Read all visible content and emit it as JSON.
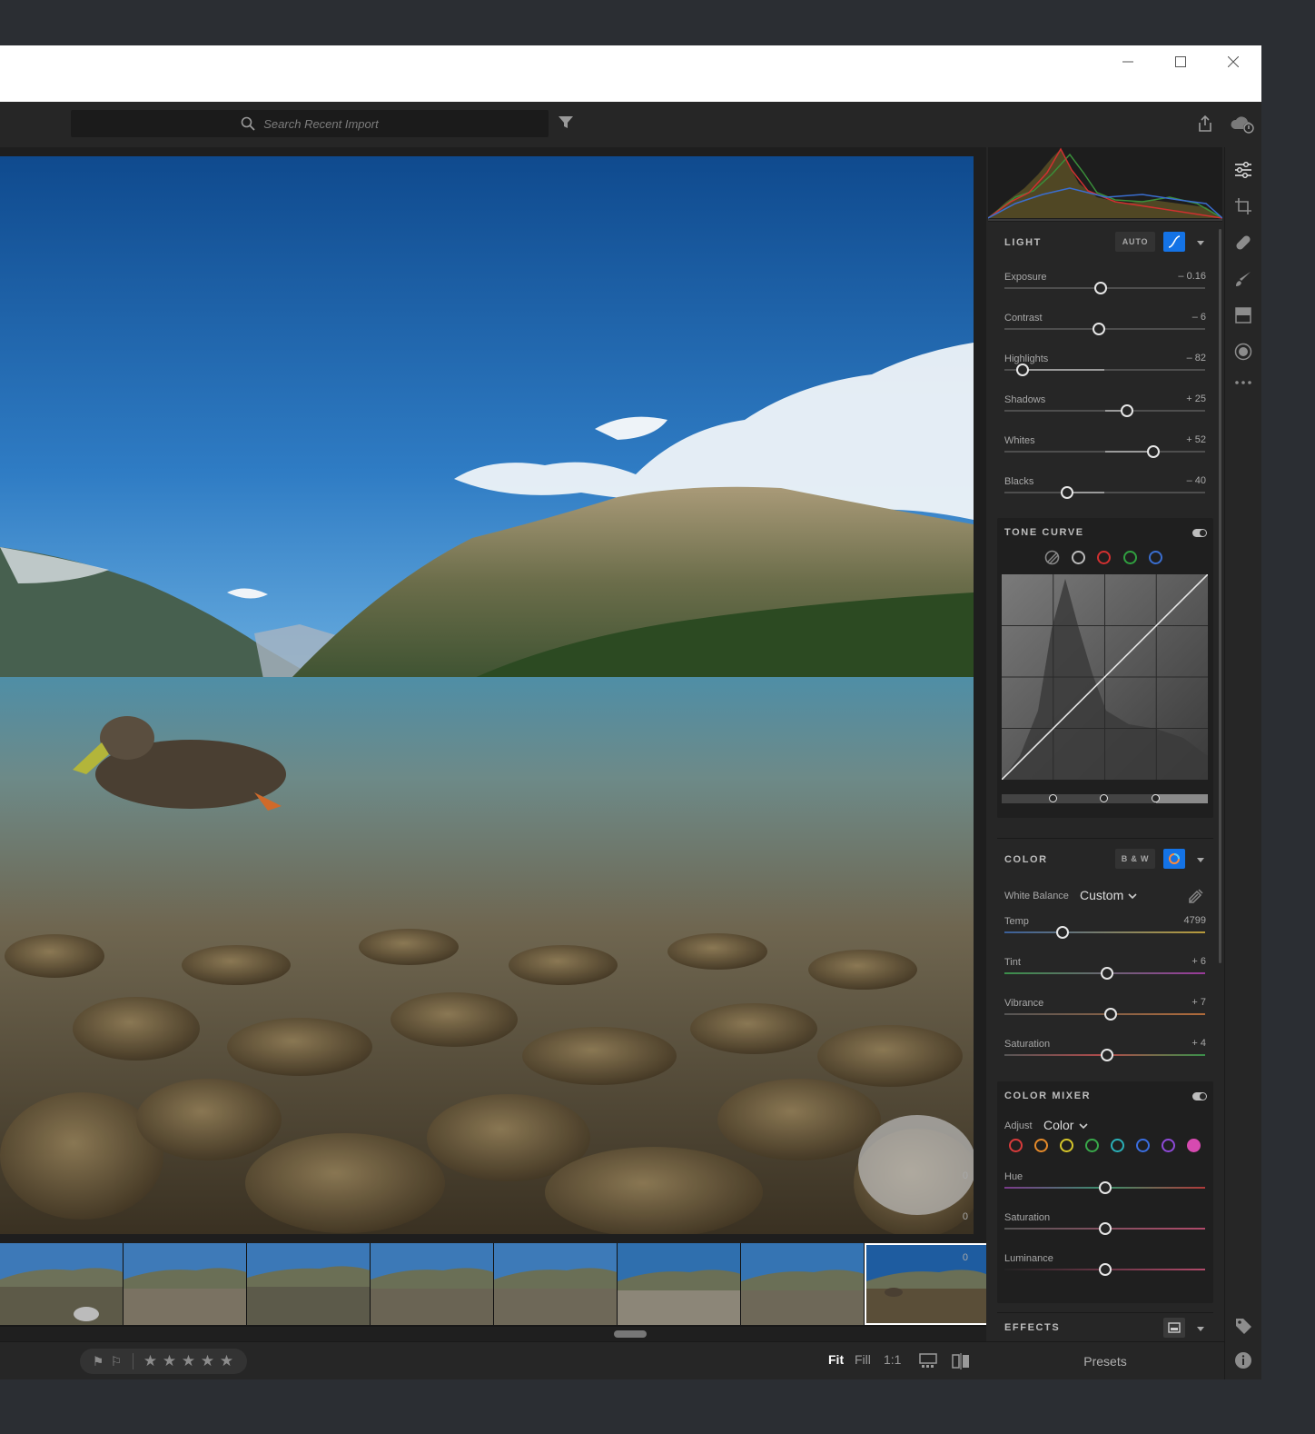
{
  "window": {
    "minimize_icon": "minimize-icon",
    "maximize_icon": "maximize-icon",
    "close_icon": "close-icon"
  },
  "toolbar": {
    "search_placeholder": "Search Recent Import",
    "filter_icon": "filter-icon",
    "share_icon": "share-icon",
    "cloud_icon": "cloud-sync-icon"
  },
  "light": {
    "title": "LIGHT",
    "auto_label": "AUTO",
    "sliders": [
      {
        "label": "Exposure",
        "value": "– 0.16",
        "pos": 0.48
      },
      {
        "label": "Contrast",
        "value": "– 6",
        "pos": 0.47
      },
      {
        "label": "Highlights",
        "value": "– 82",
        "pos": 0.09
      },
      {
        "label": "Shadows",
        "value": "+ 25",
        "pos": 0.61
      },
      {
        "label": "Whites",
        "value": "+ 52",
        "pos": 0.74
      },
      {
        "label": "Blacks",
        "value": "– 40",
        "pos": 0.31
      }
    ]
  },
  "tone_curve": {
    "title": "TONE CURVE"
  },
  "color": {
    "title": "COLOR",
    "bw_label": "B & W",
    "white_balance_label": "White Balance",
    "white_balance_value": "Custom",
    "sliders": [
      {
        "label": "Temp",
        "value": "4799",
        "pos": 0.29
      },
      {
        "label": "Tint",
        "value": "+ 6",
        "pos": 0.51
      },
      {
        "label": "Vibrance",
        "value": "+ 7",
        "pos": 0.53
      },
      {
        "label": "Saturation",
        "value": "+ 4",
        "pos": 0.51
      }
    ]
  },
  "color_mixer": {
    "title": "COLOR MIXER",
    "adjust_label": "Adjust",
    "adjust_value": "Color",
    "swatches": [
      "#d83b3b",
      "#e58a2a",
      "#d6c62a",
      "#39a84a",
      "#2ab0b8",
      "#3a6ee0",
      "#8e4ad8",
      "#d64ab0"
    ],
    "sliders": [
      {
        "label": "Hue",
        "value": "0",
        "pos": 0.5
      },
      {
        "label": "Saturation",
        "value": "0",
        "pos": 0.5
      },
      {
        "label": "Luminance",
        "value": "0",
        "pos": 0.5
      }
    ]
  },
  "effects": {
    "title": "EFFECTS"
  },
  "presets_label": "Presets",
  "bottom": {
    "zoom_fit": "Fit",
    "zoom_fill": "Fill",
    "zoom_1to1": "1:1",
    "star_glyph": "★"
  }
}
